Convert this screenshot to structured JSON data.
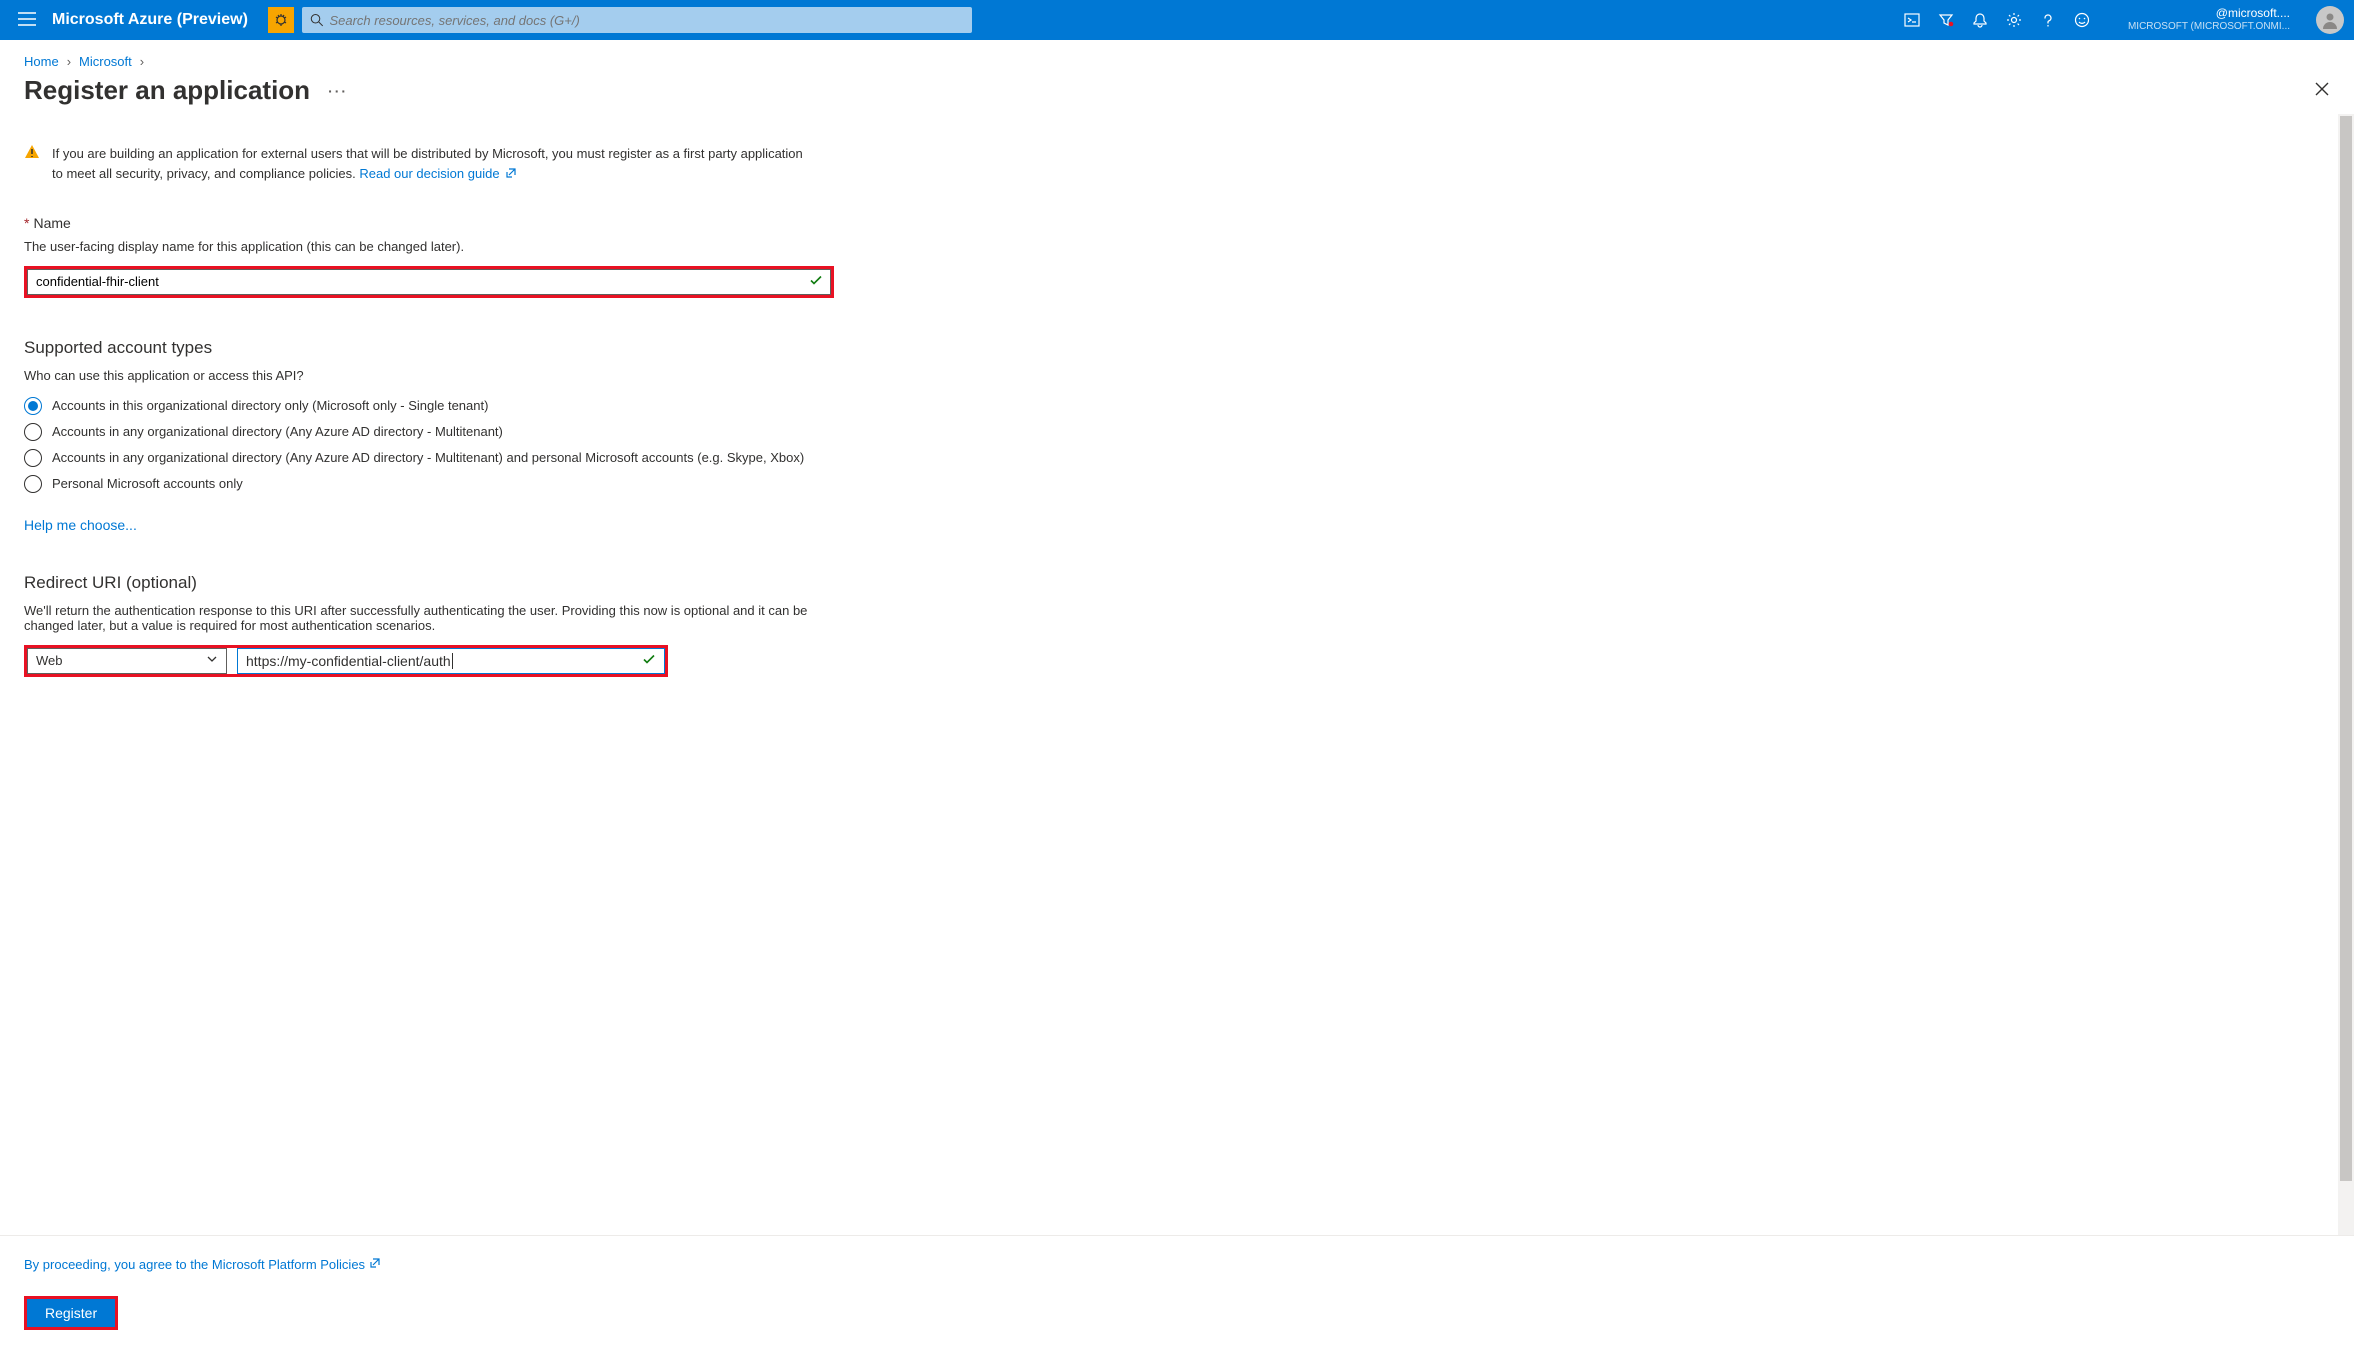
{
  "topbar": {
    "brand": "Microsoft Azure (Preview)",
    "search_placeholder": "Search resources, services, and docs (G+/)",
    "account_email": "@microsoft....",
    "account_directory": "MICROSOFT (MICROSOFT.ONMI..."
  },
  "breadcrumb": {
    "items": [
      "Home",
      "Microsoft"
    ]
  },
  "page": {
    "title": "Register an application"
  },
  "warning": {
    "text": "If you are building an application for external users that will be distributed by Microsoft, you must register as a first party application to meet all security, privacy, and compliance policies.",
    "link_text": "Read our decision guide"
  },
  "name_section": {
    "label": "Name",
    "help": "The user-facing display name for this application (this can be changed later).",
    "value": "confidential-fhir-client"
  },
  "account_types": {
    "heading": "Supported account types",
    "question": "Who can use this application or access this API?",
    "options": [
      {
        "label": "Accounts in this organizational directory only (Microsoft only - Single tenant)",
        "selected": true
      },
      {
        "label": "Accounts in any organizational directory (Any Azure AD directory - Multitenant)",
        "selected": false
      },
      {
        "label": "Accounts in any organizational directory (Any Azure AD directory - Multitenant) and personal Microsoft accounts (e.g. Skype, Xbox)",
        "selected": false
      },
      {
        "label": "Personal Microsoft accounts only",
        "selected": false
      }
    ],
    "help_link": "Help me choose..."
  },
  "redirect": {
    "heading": "Redirect URI (optional)",
    "help": "We'll return the authentication response to this URI after successfully authenticating the user. Providing this now is optional and it can be changed later, but a value is required for most authentication scenarios.",
    "platform": "Web",
    "uri": "https://my-confidential-client/auth"
  },
  "footer": {
    "policy_text": "By proceeding, you agree to the Microsoft Platform Policies",
    "register_label": "Register"
  }
}
